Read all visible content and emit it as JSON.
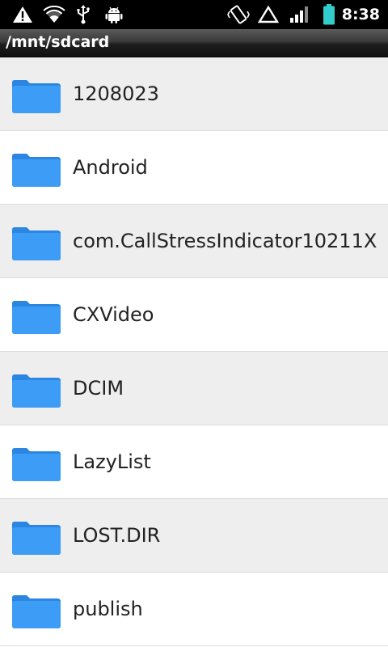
{
  "status_bar": {
    "time": "8:38",
    "icons": [
      "warning-icon",
      "wifi-icon",
      "usb-icon",
      "android-debug-icon",
      "vibrate-icon",
      "alert-triangle-icon",
      "signal-icon",
      "battery-icon"
    ]
  },
  "title_bar": {
    "path": "/mnt/sdcard"
  },
  "files": [
    {
      "name": "1208023",
      "type": "folder"
    },
    {
      "name": "Android",
      "type": "folder"
    },
    {
      "name": "com.CallStressIndicator10211X",
      "type": "folder"
    },
    {
      "name": "CXVideo",
      "type": "folder"
    },
    {
      "name": "DCIM",
      "type": "folder"
    },
    {
      "name": "LazyList",
      "type": "folder"
    },
    {
      "name": "LOST.DIR",
      "type": "folder"
    },
    {
      "name": "publish",
      "type": "folder"
    }
  ],
  "colors": {
    "folder": "#3d9cf5",
    "folder_dark": "#2a86e0",
    "row_alt": "#eeeeee",
    "battery": "#33cccc"
  }
}
